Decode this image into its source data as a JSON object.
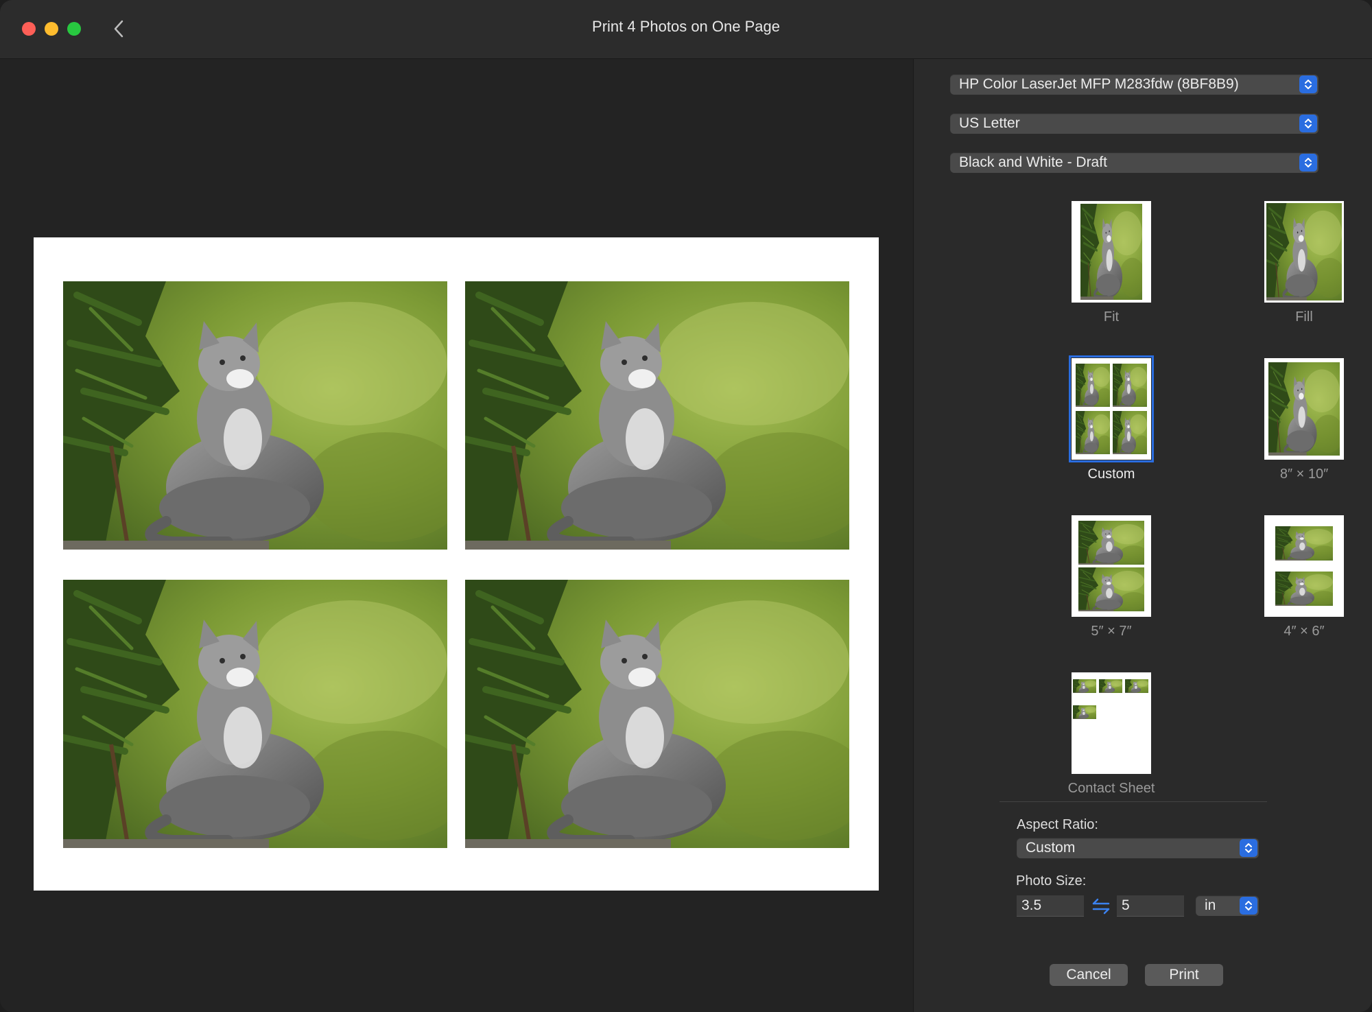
{
  "window": {
    "title": "Print 4 Photos on One Page"
  },
  "settings": {
    "printer": "HP Color LaserJet MFP M283fdw (8BF8B9)",
    "paper_size": "US Letter",
    "quality": "Black and White - Draft"
  },
  "layouts": [
    {
      "label": "Fit",
      "selected": false
    },
    {
      "label": "Fill",
      "selected": false
    },
    {
      "label": "Custom",
      "selected": true
    },
    {
      "label": "8″ × 10″",
      "selected": false
    },
    {
      "label": "5″ × 7″",
      "selected": false
    },
    {
      "label": "4″ × 6″",
      "selected": false
    },
    {
      "label": "Contact Sheet",
      "selected": false
    }
  ],
  "options": {
    "aspect_ratio_label": "Aspect Ratio:",
    "aspect_ratio_value": "Custom",
    "photo_size_label": "Photo Size:",
    "width": "3.5",
    "height": "5",
    "unit": "in"
  },
  "buttons": {
    "cancel": "Cancel",
    "print": "Print"
  },
  "colors": {
    "accent": "#2a6de0",
    "background": "#232323"
  }
}
